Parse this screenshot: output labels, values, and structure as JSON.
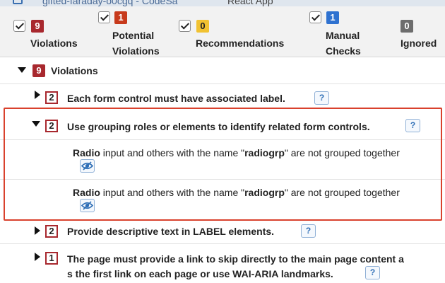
{
  "tabs": [
    {
      "label": "gifted-faraday-o0cgq - CodeSa"
    },
    {
      "label": "React App"
    }
  ],
  "filters": [
    {
      "count": "9",
      "label_line1": "",
      "label_line2": "Violations",
      "color": "#a8282e"
    },
    {
      "count": "1",
      "label_line1": "Potential",
      "label_line2": "Violations",
      "color": "#c73a1c"
    },
    {
      "count": "0",
      "label_line1": "",
      "label_line2": "Recommendations",
      "color": "#f1c232"
    },
    {
      "count": "1",
      "label_line1": "Manual",
      "label_line2": "Checks",
      "color": "#2f72d0"
    },
    {
      "count": "0",
      "label_line1": "",
      "label_line2": "Ignored",
      "color": "#6d6d6d"
    }
  ],
  "section": {
    "count": "9",
    "label": "Violations"
  },
  "rules": [
    {
      "count": "2",
      "label": "Each form control must have associated label.",
      "help": "?"
    },
    {
      "count": "2",
      "label": "Use grouping roles or elements to identify related form controls.",
      "help": "?"
    },
    {
      "count": "2",
      "label": "Provide descriptive text in LABEL elements.",
      "help": "?"
    },
    {
      "count": "1",
      "label_line1": "The page must provide a link to skip directly to the main page content a",
      "label_line2": "s the first link on each page or use WAI-ARIA landmarks.",
      "help": "?"
    }
  ],
  "messages": [
    {
      "strong1": "Radio",
      "text1": " input and others with the name \"",
      "strong2": "radiogrp",
      "text2": "\" are not grouped together"
    },
    {
      "strong1": "Radio",
      "text1": " input and others with the name \"",
      "strong2": "radiogrp",
      "text2": "\" are not grouped together"
    }
  ],
  "icons": {
    "checkbox": "checkmark-icon",
    "expanded": "triangle-down-icon",
    "collapsed": "triangle-right-icon",
    "help": "question-mark-icon",
    "view": "eye-slash-icon"
  },
  "colors": {
    "violation": "#a8282e",
    "highlight": "#d9412d",
    "help_blue": "#2f6fb6"
  }
}
